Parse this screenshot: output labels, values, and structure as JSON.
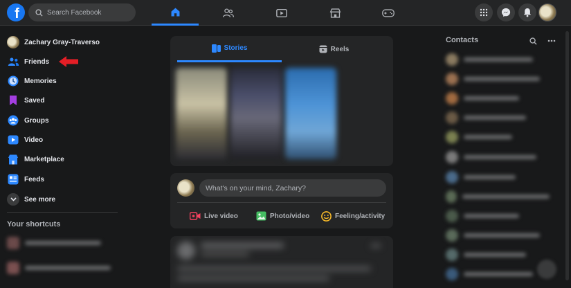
{
  "header": {
    "logo": "facebook-logo",
    "search_placeholder": "Search Facebook",
    "nav_tabs": [
      {
        "name": "home",
        "active": true
      },
      {
        "name": "friends",
        "active": false
      },
      {
        "name": "watch",
        "active": false
      },
      {
        "name": "marketplace",
        "active": false
      },
      {
        "name": "gaming",
        "active": false
      }
    ],
    "actions": [
      "menu-grid-icon",
      "messenger-icon",
      "notifications-icon",
      "profile-avatar"
    ]
  },
  "sidebar": {
    "profile_name": "Zachary Gray-Traverso",
    "items": [
      {
        "label": "Friends",
        "icon": "friends-icon"
      },
      {
        "label": "Memories",
        "icon": "memories-icon"
      },
      {
        "label": "Saved",
        "icon": "saved-icon"
      },
      {
        "label": "Groups",
        "icon": "groups-icon"
      },
      {
        "label": "Video",
        "icon": "video-icon"
      },
      {
        "label": "Marketplace",
        "icon": "marketplace-icon"
      },
      {
        "label": "Feeds",
        "icon": "feeds-icon"
      }
    ],
    "see_more": "See more",
    "shortcuts_title": "Your shortcuts"
  },
  "stories": {
    "tabs": [
      {
        "label": "Stories",
        "active": true
      },
      {
        "label": "Reels",
        "active": false
      }
    ]
  },
  "composer": {
    "placeholder": "What's on your mind, Zachary?",
    "actions": [
      {
        "label": "Live video",
        "color": "#f3425f"
      },
      {
        "label": "Photo/video",
        "color": "#45bd62"
      },
      {
        "label": "Feeling/activity",
        "color": "#f7b928"
      }
    ]
  },
  "contacts": {
    "title": "Contacts"
  },
  "colors": {
    "accent": "#2d88ff",
    "background": "#18191a",
    "surface": "#242526",
    "annotation_arrow": "#e41e26"
  }
}
